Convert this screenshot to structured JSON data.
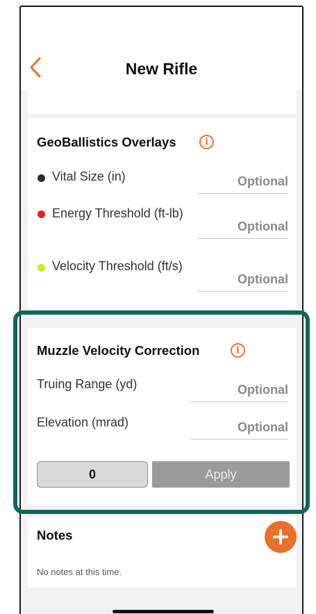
{
  "header": {
    "title": "New Rifle",
    "back_icon": "chevron-left-icon"
  },
  "geo_overlays": {
    "title": "GeoBallistics Overlays",
    "info_icon": "info-icon",
    "fields": [
      {
        "label": "Vital Size (in)",
        "placeholder": "Optional",
        "dot_color": "#2b2b2b"
      },
      {
        "label": "Energy Threshold (ft-lb)",
        "placeholder": "Optional",
        "dot_color": "#e8202a"
      },
      {
        "label": "Velocity Threshold (ft/s)",
        "placeholder": "Optional",
        "dot_color": "#d6e82a"
      }
    ]
  },
  "mv_correction": {
    "title": "Muzzle Velocity Correction",
    "info_icon": "info-icon",
    "fields": [
      {
        "label": "Truing Range (yd)",
        "placeholder": "Optional"
      },
      {
        "label": "Elevation (mrad)",
        "placeholder": "Optional"
      }
    ],
    "value": "0",
    "apply_label": "Apply"
  },
  "notes": {
    "title": "Notes",
    "empty_text": "No notes at this time.",
    "add_icon": "plus-icon"
  },
  "colors": {
    "accent": "#e8702a",
    "highlight_frame": "#0f665a",
    "apply_button": "#9b9b9b"
  }
}
